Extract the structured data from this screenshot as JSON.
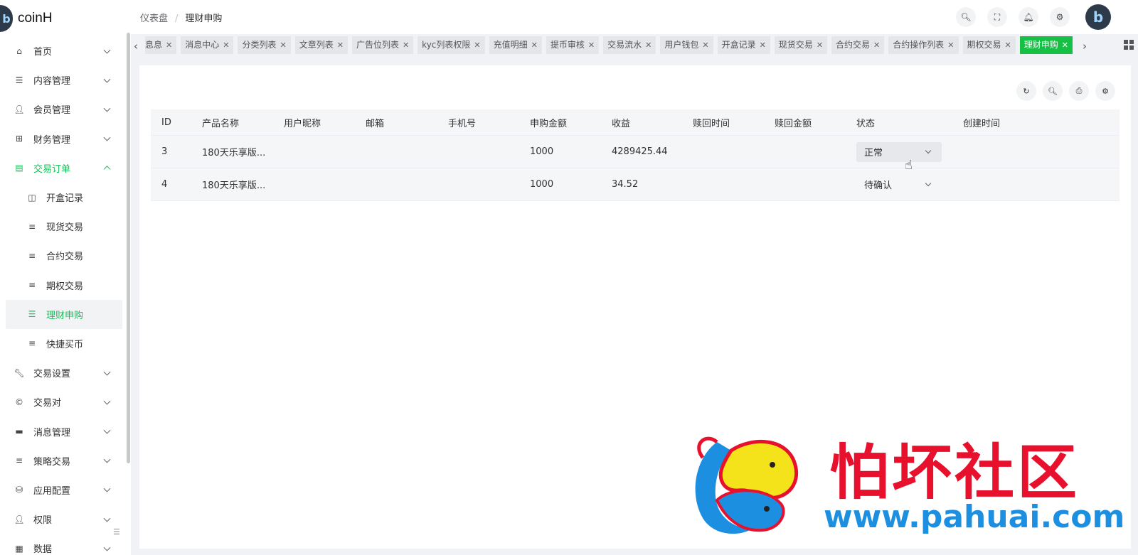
{
  "app": {
    "name": "coinH"
  },
  "colors": {
    "accent": "#18c05a",
    "tab_active": "#16c045",
    "watermark_red": "#e8112d",
    "watermark_blue": "#1d8fe0"
  },
  "sidebar": {
    "items": [
      {
        "label": "首页",
        "icon": "home-icon",
        "expandable": true
      },
      {
        "label": "内容管理",
        "icon": "list-icon",
        "expandable": true
      },
      {
        "label": "会员管理",
        "icon": "user-icon",
        "expandable": true
      },
      {
        "label": "财务管理",
        "icon": "table-icon",
        "expandable": true
      },
      {
        "label": "交易订单",
        "icon": "order-icon",
        "expandable": true,
        "expanded": true
      },
      {
        "label": "开盒记录",
        "icon": "box-icon",
        "sub": true
      },
      {
        "label": "现货交易",
        "icon": "menu-icon",
        "sub": true
      },
      {
        "label": "合约交易",
        "icon": "menu-icon",
        "sub": true
      },
      {
        "label": "期权交易",
        "icon": "menu-icon",
        "sub": true
      },
      {
        "label": "理财申购",
        "icon": "list-icon",
        "sub": true,
        "active": true
      },
      {
        "label": "快捷买币",
        "icon": "align-icon",
        "sub": true
      },
      {
        "label": "交易设置",
        "icon": "wrench-icon",
        "expandable": true
      },
      {
        "label": "交易对",
        "icon": "copyright-icon",
        "expandable": true
      },
      {
        "label": "消息管理",
        "icon": "message-icon",
        "expandable": true
      },
      {
        "label": "策略交易",
        "icon": "menu-icon",
        "expandable": true
      },
      {
        "label": "应用配置",
        "icon": "database-icon",
        "expandable": true
      },
      {
        "label": "权限",
        "icon": "user-lock-icon",
        "expandable": true
      },
      {
        "label": "数据",
        "icon": "data-icon",
        "expandable": true
      }
    ]
  },
  "header": {
    "breadcrumb": [
      "仪表盘",
      "理财申购"
    ],
    "separator": "/"
  },
  "tabs": [
    {
      "label": "息息"
    },
    {
      "label": "消息中心"
    },
    {
      "label": "分类列表"
    },
    {
      "label": "文章列表"
    },
    {
      "label": "广告位列表"
    },
    {
      "label": "kyc列表权限"
    },
    {
      "label": "充值明细"
    },
    {
      "label": "提币审核"
    },
    {
      "label": "交易流水"
    },
    {
      "label": "用户钱包"
    },
    {
      "label": "开盒记录"
    },
    {
      "label": "现货交易"
    },
    {
      "label": "合约交易"
    },
    {
      "label": "合约操作列表"
    },
    {
      "label": "期权交易"
    },
    {
      "label": "理财申购",
      "active": true
    }
  ],
  "table": {
    "columns": [
      "ID",
      "产品名称",
      "用户昵称",
      "邮箱",
      "手机号",
      "申购金额",
      "收益",
      "赎回时间",
      "赎回金额",
      "状态",
      "创建时间"
    ],
    "rows": [
      {
        "id": "3",
        "product": "180天乐享版...",
        "nickname": "",
        "email": "",
        "phone": "",
        "amount": "1000",
        "income": "4289425.44",
        "redeem_time": "",
        "redeem_amount": "",
        "status": "正常",
        "created": ""
      },
      {
        "id": "4",
        "product": "180天乐享版...",
        "nickname": "",
        "email": "",
        "phone": "",
        "amount": "1000",
        "income": "34.52",
        "redeem_time": "",
        "redeem_amount": "",
        "status": "待确认",
        "created": ""
      }
    ]
  },
  "watermark": {
    "cn": "怕坏社区",
    "url": "www.pahuai.com"
  }
}
